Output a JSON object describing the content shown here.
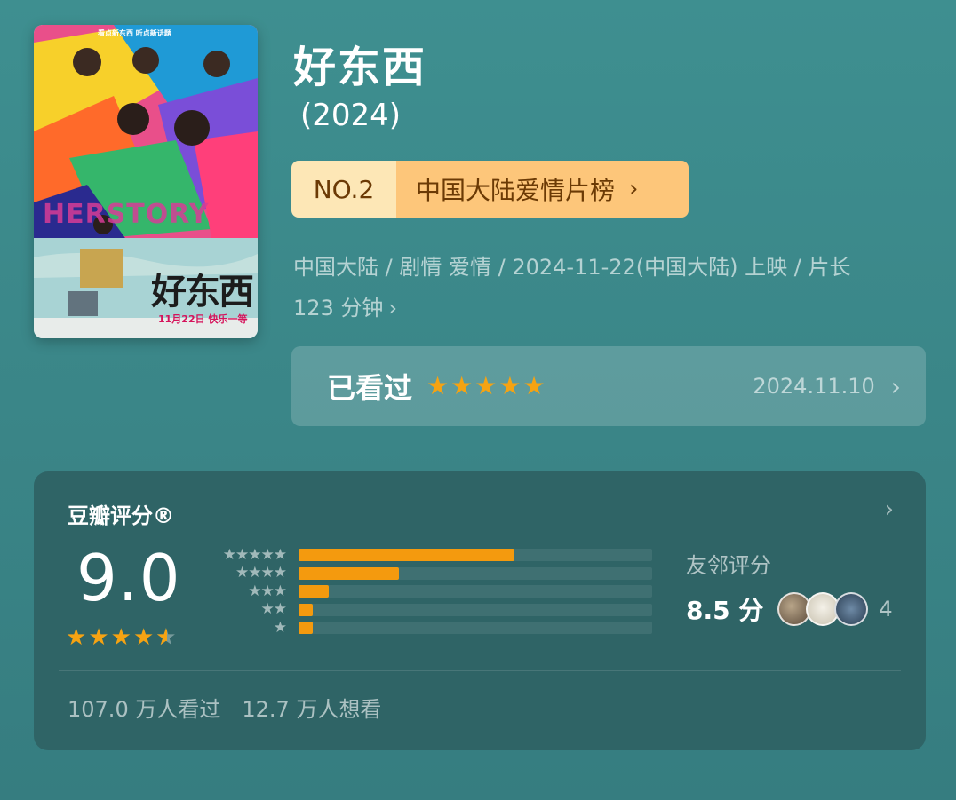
{
  "movie": {
    "title": "好东西",
    "year": "(2024)",
    "poster": {
      "title": "好东西",
      "subtitle": "HERSTORY",
      "date": "11月22日 快乐一等",
      "top_text": "看点新东西 听点新话题"
    },
    "rank": {
      "no": "NO.2",
      "list": "中国大陆爱情片榜"
    },
    "meta_line1": "中国大陆 / 剧情 爱情 / 2024-11-22(中国大陆) 上映 / 片长",
    "meta_line2": "123 分钟"
  },
  "watched": {
    "label": "已看过",
    "stars": 5,
    "date": "2024.11.10"
  },
  "rating": {
    "title": "豆瓣评分®",
    "score": "9.0",
    "stars_value": 4.5,
    "distribution": [
      {
        "stars": "★★★★★",
        "fraction": 0.61
      },
      {
        "stars": "★★★★",
        "fraction": 0.285
      },
      {
        "stars": "★★★",
        "fraction": 0.085
      },
      {
        "stars": "★★",
        "fraction": 0.04
      },
      {
        "stars": "★",
        "fraction": 0.04
      }
    ],
    "friends_label": "友邻评分",
    "friends_score": "8.5 分",
    "friends_count": "4",
    "watched_count": "107.0 万人看过",
    "wish_count": "12.7 万人想看"
  },
  "colors": {
    "accent_star": "#f6a312",
    "bar_fill": "#f49a0e",
    "rank_no_bg": "#fde7b6",
    "rank_list_bg": "#fdc67a"
  },
  "icons": {
    "chevron": "chevron-right-icon",
    "star": "star-icon"
  }
}
